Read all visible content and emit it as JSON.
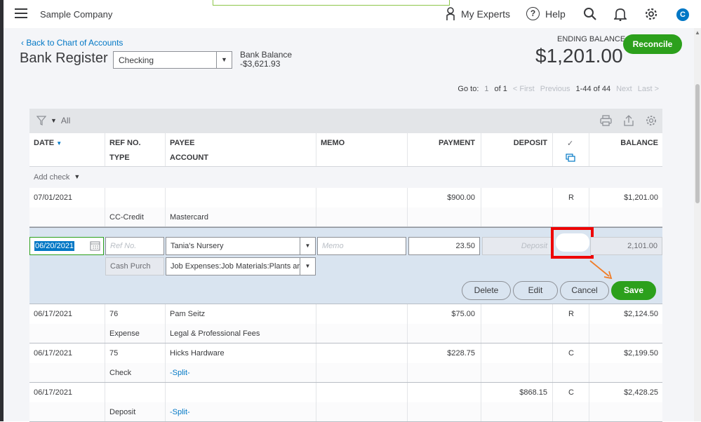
{
  "topbar": {
    "company": "Sample Company",
    "experts": "My Experts",
    "help": "Help",
    "avatar_initial": "C"
  },
  "header": {
    "back_link": "Back to Chart of Accounts",
    "title": "Bank Register",
    "account_value": "Checking",
    "bank_balance_label": "Bank Balance",
    "bank_balance_value": "-$3,621.93",
    "ending_label": "ENDING BALANCE",
    "ending_amount": "$1,201.00",
    "reconcile": "Reconcile"
  },
  "paging": {
    "goto": "Go to:",
    "page": "1",
    "of": "of 1",
    "first": "< First",
    "previous": "Previous",
    "range": "1-44 of 44",
    "next": "Next",
    "last": "Last >"
  },
  "toolbar": {
    "filter": "All"
  },
  "columns": {
    "date": "DATE",
    "ref": "REF NO.",
    "type": "TYPE",
    "payee": "PAYEE",
    "account": "ACCOUNT",
    "memo": "MEMO",
    "payment": "PAYMENT",
    "deposit": "DEPOSIT",
    "check": "✓",
    "balance": "BALANCE"
  },
  "add_check": "Add check",
  "rows_top": [
    {
      "date": "07/01/2021",
      "ref": "",
      "payee": "",
      "memo": "",
      "payment": "$900.00",
      "deposit": "",
      "status": "R",
      "balance": "$1,201.00",
      "type": "CC-Credit",
      "account": "Mastercard"
    }
  ],
  "edit_row": {
    "date": "06/20/2021",
    "ref_placeholder": "Ref No.",
    "payee": "Tania's Nursery",
    "memo_placeholder": "Memo",
    "payment": "23.50",
    "deposit_placeholder": "Deposit",
    "balance": "2,101.00",
    "type": "Cash Purch",
    "account": "Job Expenses:Job Materials:Plants ar",
    "delete": "Delete",
    "edit": "Edit",
    "cancel": "Cancel",
    "save": "Save"
  },
  "rows": [
    {
      "date": "06/17/2021",
      "ref": "76",
      "payee": "Pam Seitz",
      "payment": "$75.00",
      "deposit": "",
      "status": "R",
      "balance": "$2,124.50",
      "type": "Expense",
      "account": "Legal & Professional Fees"
    },
    {
      "date": "06/17/2021",
      "ref": "75",
      "payee": "Hicks Hardware",
      "payment": "$228.75",
      "deposit": "",
      "status": "C",
      "balance": "$2,199.50",
      "type": "Check",
      "account": "-Split-"
    },
    {
      "date": "06/17/2021",
      "ref": "",
      "payee": "",
      "payment": "",
      "deposit": "$868.15",
      "status": "C",
      "balance": "$2,428.25",
      "type": "Deposit",
      "account": "-Split-"
    }
  ],
  "colors": {
    "accent": "#2ca01c",
    "link": "#0077c5",
    "highlight": "#e00000",
    "arrow": "#f07c27"
  }
}
